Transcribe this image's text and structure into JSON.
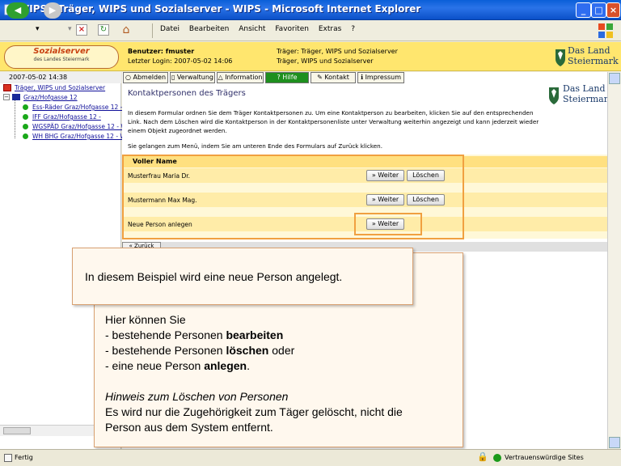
{
  "window": {
    "title": "WIPS - Träger, WIPS und Sozialserver - WIPS - Microsoft Internet Explorer",
    "min_label": "_",
    "max_label": "□",
    "close_label": "×"
  },
  "menubar": {
    "items": [
      "Datei",
      "Bearbeiten",
      "Ansicht",
      "Favoriten",
      "Extras",
      "?"
    ]
  },
  "header": {
    "logo_line1": "Sozialserver",
    "logo_line2": "des Landes Steiermark",
    "user_line": "Benutzer: fmuster",
    "login_line": "Letzter Login: 2007-05-02 14:06",
    "traeger_line": "Träger: Träger, WIPS und Sozialserver",
    "traeger_line2": "Träger, WIPS und Sozialserver",
    "land_line1": "Das Land",
    "land_line2": "Steiermark"
  },
  "sidebar": {
    "date": "2007-05-02 14:38",
    "root": "Träger, WIPS und Sozialserver",
    "location": "Graz/Hofgasse 12",
    "items": [
      "Ess-Räder Graz/Hofgasse 12 -",
      "IFF Graz/Hofgasse 12 -",
      "WGSPÄD Graz/Hofgasse 12 - W",
      "WH BHG Graz/Hofgasse 12 - W"
    ]
  },
  "nav": {
    "tabs": [
      "Abmelden",
      "Verwaltung",
      "Information",
      "Hilfe",
      "Kontakt",
      "Impressum"
    ]
  },
  "main": {
    "title": "Kontaktpersonen des Trägers",
    "intro": "In diesem Formular ordnen Sie dem Träger Kontaktpersonen zu. Um eine Kontaktperson zu bearbeiten, klicken Sie auf den entsprechenden Link. Nach dem Löschen wird die Kontaktperson in der Kontaktpersonenliste unter Verwaltung weiterhin angezeigt und kann jederzeit wieder einem Objekt zugeordnet werden.",
    "back_hint": "Sie gelangen zum Menü, indem Sie am unteren Ende des Formulars auf Zurück klicken.",
    "table_header": "Voller Name",
    "rows": [
      {
        "name": "Musterfrau Maria Dr.",
        "weiter": "» Weiter",
        "loeschen": "Löschen"
      },
      {
        "name": "Mustermann Max Mag.",
        "weiter": "» Weiter",
        "loeschen": "Löschen"
      },
      {
        "name": "Neue Person anlegen",
        "weiter": "» Weiter"
      }
    ],
    "back_button": "« Zurück"
  },
  "callouts": {
    "first": "In diesem Beispiel wird eine neue Person angelegt.",
    "second_intro": "Hier können Sie",
    "second_lines": [
      {
        "prefix": "- bestehende Personen ",
        "bold": "bearbeiten",
        "suffix": ""
      },
      {
        "prefix": "- bestehende Personen ",
        "bold": "löschen",
        "suffix": " oder"
      },
      {
        "prefix": "- eine neue Person ",
        "bold": "anlegen",
        "suffix": "."
      }
    ],
    "hint_title": "Hinweis zum Löschen von Personen",
    "hint_text1": "Es wird nur die Zugehörigkeit zum Täger gelöscht, nicht die",
    "hint_text2": "Person aus dem System entfernt."
  },
  "statusbar": {
    "status": "Fertig",
    "zone": "Vertrauenswürdige Sites"
  },
  "colors": {
    "header_bg": "#ffe66e",
    "tab_active": "#1e8f1e",
    "highlight": "#f0a040"
  }
}
